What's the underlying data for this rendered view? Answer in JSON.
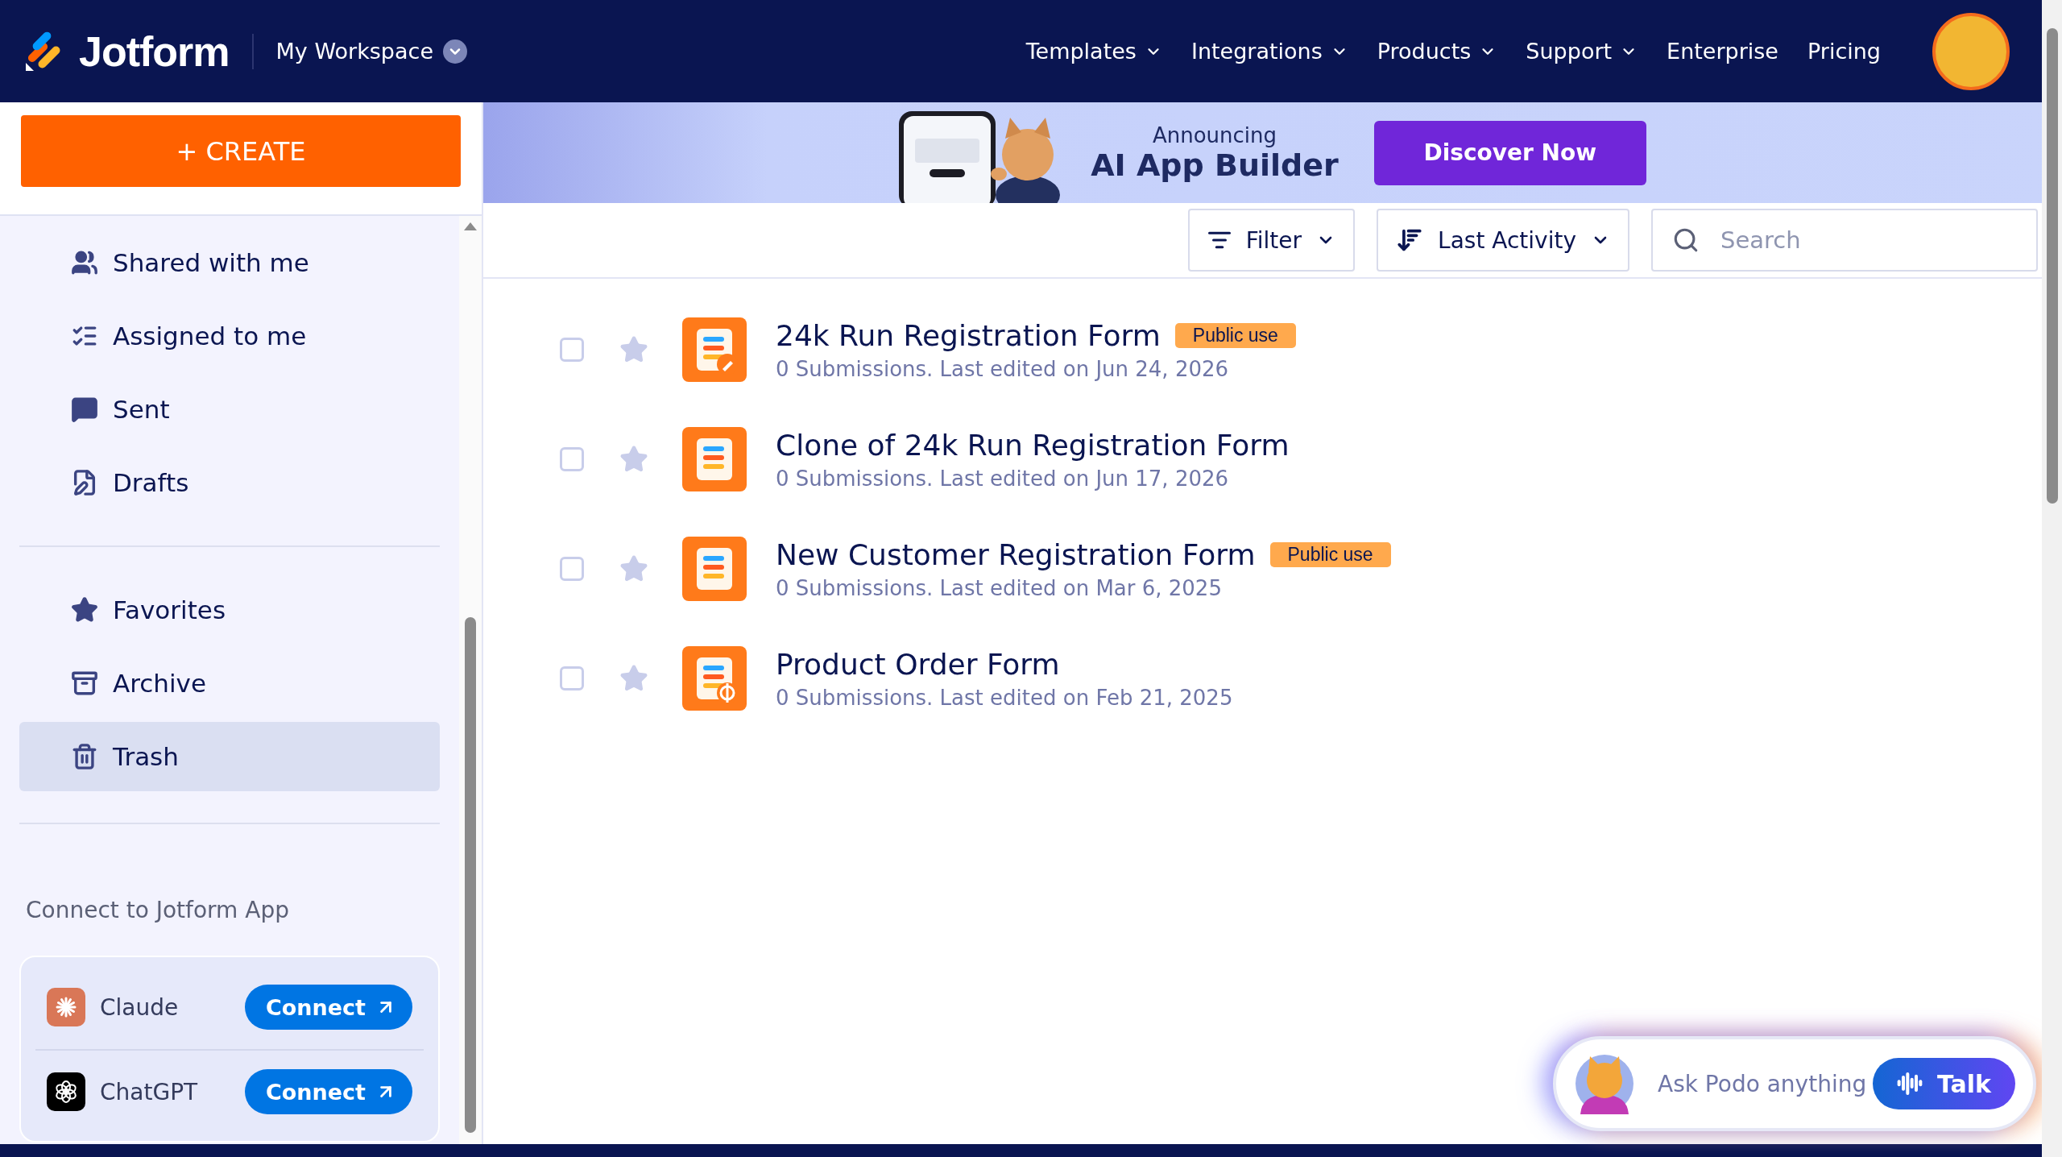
{
  "header": {
    "logo": "Jotform",
    "workspace": "My Workspace",
    "nav": [
      {
        "label": "Templates",
        "dropdown": true
      },
      {
        "label": "Integrations",
        "dropdown": true
      },
      {
        "label": "Products",
        "dropdown": true
      },
      {
        "label": "Support",
        "dropdown": true
      },
      {
        "label": "Enterprise",
        "dropdown": false
      },
      {
        "label": "Pricing",
        "dropdown": false
      }
    ]
  },
  "sidebar": {
    "create": "+ CREATE",
    "groups": [
      [
        {
          "label": "Shared with me",
          "kind": "shared",
          "selected": false
        },
        {
          "label": "Assigned to me",
          "kind": "assigned",
          "selected": false
        },
        {
          "label": "Sent",
          "kind": "sent",
          "selected": false
        },
        {
          "label": "Drafts",
          "kind": "drafts",
          "selected": false
        }
      ],
      [
        {
          "label": "Favorites",
          "kind": "favorites",
          "selected": false
        },
        {
          "label": "Archive",
          "kind": "archive",
          "selected": false
        },
        {
          "label": "Trash",
          "kind": "trash",
          "selected": true
        }
      ]
    ],
    "connect_title": "Connect to Jotform App",
    "apps": [
      {
        "name": "Claude",
        "kind": "claude",
        "button": "Connect"
      },
      {
        "name": "ChatGPT",
        "kind": "chatgpt",
        "button": "Connect"
      }
    ]
  },
  "banner": {
    "eyebrow": "Announcing",
    "title": "AI App Builder",
    "button": "Discover Now"
  },
  "toolbar": {
    "filter": "Filter",
    "sort": "Last Activity",
    "search": {
      "placeholder": "Search"
    }
  },
  "forms": [
    {
      "title": "24k Run Registration Form",
      "badge": "Public use",
      "meta": "0 Submissions. Last edited on Jun 24, 2026",
      "kind": "sign",
      "checked": false,
      "starred": false
    },
    {
      "title": "Clone of 24k Run Registration Form",
      "meta": "0 Submissions. Last edited on Jun 17, 2026",
      "kind": "plain",
      "checked": false,
      "starred": false
    },
    {
      "title": "New Customer Registration Form",
      "badge": "Public use",
      "meta": "0 Submissions. Last edited on Mar 6, 2025",
      "kind": "plain",
      "checked": false,
      "starred": false
    },
    {
      "title": "Product Order Form",
      "meta": "0 Submissions. Last edited on Feb 21, 2025",
      "kind": "payment",
      "checked": false,
      "starred": false
    }
  ],
  "assistant": {
    "placeholder": "Ask Podo anything",
    "button": "Talk"
  }
}
